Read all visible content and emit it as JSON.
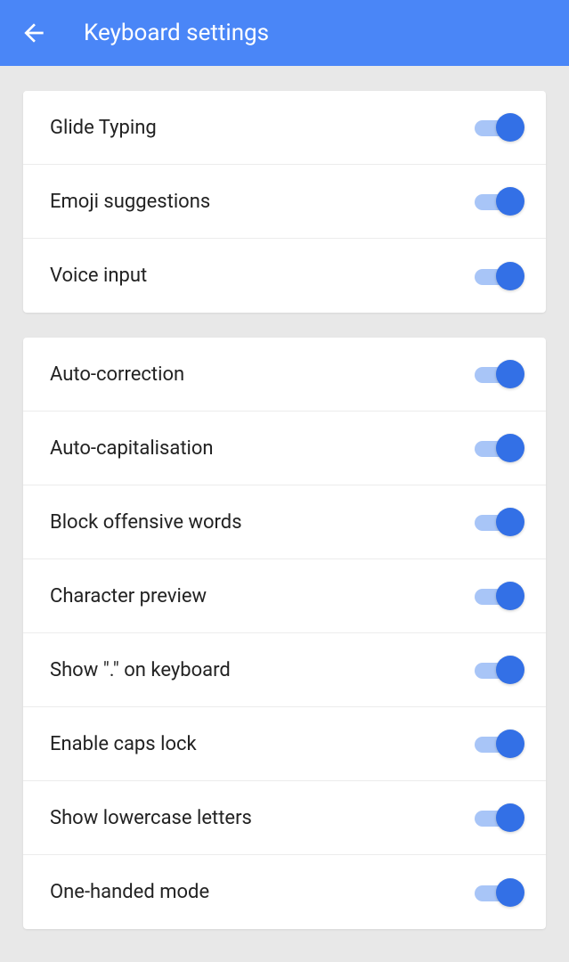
{
  "header": {
    "title": "Keyboard settings"
  },
  "groups": [
    {
      "items": [
        {
          "label": "Glide Typing",
          "on": true
        },
        {
          "label": "Emoji suggestions",
          "on": true
        },
        {
          "label": "Voice input",
          "on": true
        }
      ]
    },
    {
      "items": [
        {
          "label": "Auto-correction",
          "on": true
        },
        {
          "label": "Auto-capitalisation",
          "on": true
        },
        {
          "label": "Block offensive words",
          "on": true
        },
        {
          "label": "Character preview",
          "on": true
        },
        {
          "label": "Show \".\" on keyboard",
          "on": true
        },
        {
          "label": "Enable caps lock",
          "on": true
        },
        {
          "label": "Show lowercase letters",
          "on": true
        },
        {
          "label": "One-handed mode",
          "on": true
        }
      ]
    }
  ]
}
